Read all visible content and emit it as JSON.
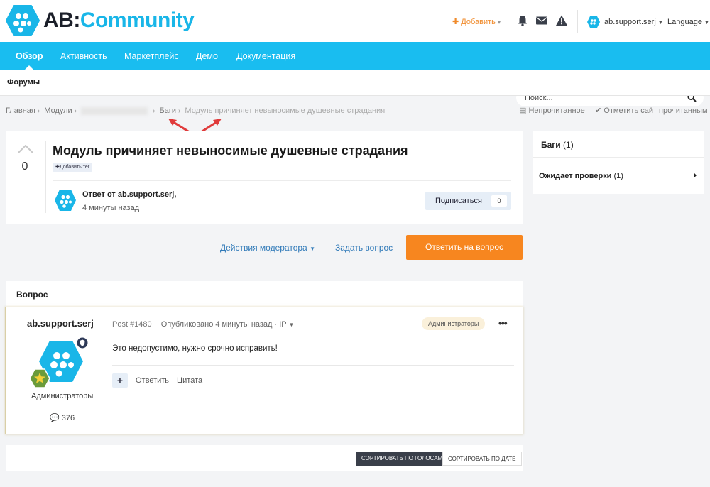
{
  "header": {
    "brand_prefix": "AB:",
    "brand_name": "Community",
    "add_label": "Добавить",
    "user_name": "ab.support.serj",
    "language_label": "Language"
  },
  "nav": {
    "items": [
      "Обзор",
      "Активность",
      "Маркетплейс",
      "Демо",
      "Документация"
    ],
    "active_index": 0,
    "search_placeholder": "Поиск..."
  },
  "subnav": {
    "item": "Форумы"
  },
  "breadcrumb": {
    "items": [
      "Главная",
      "Модули",
      "Баги"
    ],
    "current": "Модуль причиняет невыносимые душевные страдания"
  },
  "top_actions": {
    "unread": "Непрочитанное",
    "mark_read": "Отметить сайт прочитанным"
  },
  "question": {
    "votes": "0",
    "title": "Модуль причиняет невыносимые душевные страдания",
    "add_tag": "Добавить тег",
    "reply_by": "Ответ от ab.support.serj,",
    "reply_time": "4 минуты назад",
    "follow_label": "Подписаться",
    "follow_count": "0"
  },
  "actions": {
    "moderator": "Действия модератора",
    "ask": "Задать вопрос",
    "answer": "Ответить на вопрос"
  },
  "sidebar": {
    "title": "Баги",
    "title_count": "(1)",
    "item_label": "Ожидает проверки",
    "item_count": "(1)"
  },
  "post_section": {
    "title": "Вопрос"
  },
  "post": {
    "author": "ab.support.serj",
    "role": "Администраторы",
    "count": "376",
    "number": "Post #1480",
    "meta": "Опубликовано 4 минуты назад · IP",
    "badge": "Администраторы",
    "body": "Это недопустимо, нужно срочно исправить!",
    "reply": "Ответить",
    "quote": "Цитата"
  },
  "sort": {
    "by_votes": "Сортировать по голосам",
    "by_date": "Сортировать по дате"
  },
  "colors": {
    "accent": "#19bdf0",
    "brand_dark": "#1b1f29",
    "answer_button": "#f7861f",
    "link": "#2f79b8"
  },
  "icons": [
    "bell-icon",
    "envelope-icon",
    "warning-icon",
    "search-icon",
    "comment-icon",
    "shield-icon",
    "star-icon",
    "check-icon",
    "newspaper-icon",
    "ellipsis-icon"
  ]
}
